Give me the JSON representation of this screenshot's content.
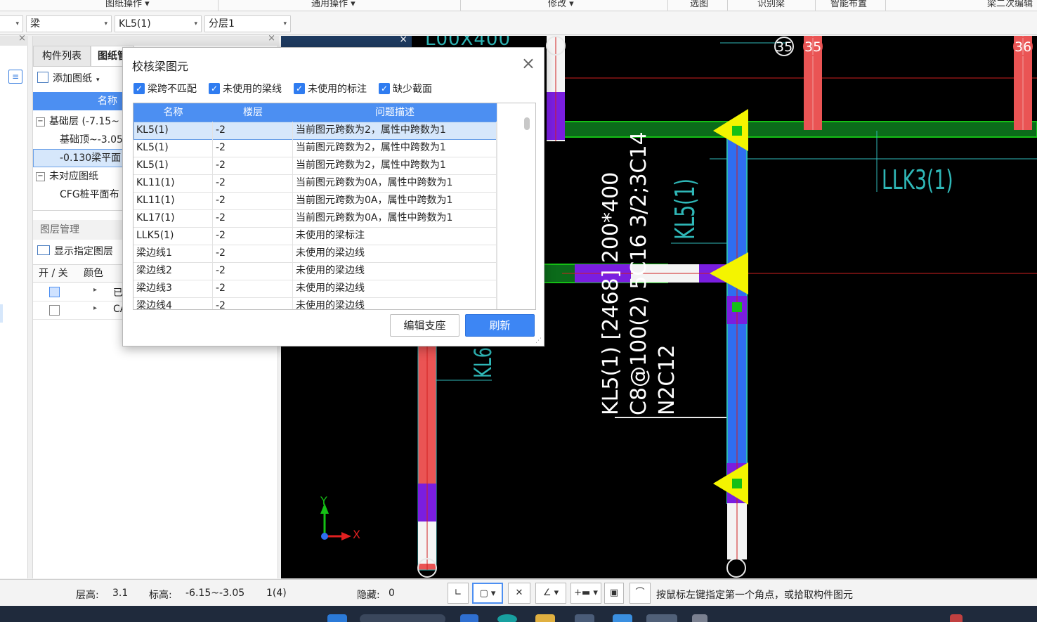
{
  "ribbon": {
    "groups": [
      "图纸操作 ▾",
      "通用操作 ▾",
      "修改 ▾",
      "选图",
      "识别梁",
      "智能布置",
      "梁二次编辑"
    ]
  },
  "selectors": {
    "first_arrow": "▾",
    "element_type": "梁",
    "element_name": "KL5(1)",
    "layer": "分层1"
  },
  "left_panel": {
    "tabs": [
      "构件列表",
      "图纸管"
    ],
    "add_drawing": "添加图纸",
    "column_header": "名称",
    "tree": [
      {
        "label": "基础层 (-7.15~",
        "level": 0,
        "expander": "−"
      },
      {
        "label": "基础顶~-3.05",
        "level": 1
      },
      {
        "label": "-0.130梁平面",
        "level": 1,
        "selected": true
      },
      {
        "label": "未对应图纸",
        "level": 0,
        "expander": "−"
      },
      {
        "label": "CFG桩平面布",
        "level": 1
      }
    ],
    "layer_mgmt": "图层管理",
    "show_layers": "显示指定图层",
    "layer_cols": [
      "开 / 关",
      "颜色"
    ],
    "layer_rows": [
      {
        "arrow": "▸",
        "name": "已"
      },
      {
        "arrow": "▸",
        "name": "CA"
      }
    ]
  },
  "canvas": {
    "grid_bubbles": [
      "35",
      "35",
      "36"
    ],
    "beam_title": "LLK3(1)",
    "beam_tag_kl5": "KL5(1)",
    "annotation": {
      "line1": "KL5(1) [2468] 200*400",
      "line2": "C8@100(2) 5C16 3/2;3C14",
      "line3": "N2C12"
    },
    "top_label": "L00X400",
    "left_tag": "KL6",
    "axis_x": "X",
    "axis_y": "Y",
    "inner_close": "×",
    "colors": {
      "red_beam": "#ea5454",
      "purple": "#7a1ee0",
      "blue_beam": "#2f6ef0",
      "yellow": "#f4f400",
      "green": "#15c015",
      "cyan": "#2fb8b8"
    }
  },
  "dialog": {
    "title": "校核梁图元",
    "close": "×",
    "filters": [
      "梁跨不匹配",
      "未使用的梁线",
      "未使用的标注",
      "缺少截面"
    ],
    "columns": [
      "名称",
      "楼层",
      "问题描述"
    ],
    "rows": [
      {
        "name": "KL5(1)",
        "floor": "-2",
        "desc": "当前图元跨数为2，属性中跨数为1"
      },
      {
        "name": "KL5(1)",
        "floor": "-2",
        "desc": "当前图元跨数为2，属性中跨数为1"
      },
      {
        "name": "KL5(1)",
        "floor": "-2",
        "desc": "当前图元跨数为2，属性中跨数为1"
      },
      {
        "name": "KL11(1)",
        "floor": "-2",
        "desc": "当前图元跨数为0A，属性中跨数为1"
      },
      {
        "name": "KL11(1)",
        "floor": "-2",
        "desc": "当前图元跨数为0A，属性中跨数为1"
      },
      {
        "name": "KL17(1)",
        "floor": "-2",
        "desc": "当前图元跨数为0A，属性中跨数为1"
      },
      {
        "name": "LLK5(1)",
        "floor": "-2",
        "desc": "未使用的梁标注"
      },
      {
        "name": "梁边线1",
        "floor": "-2",
        "desc": "未使用的梁边线"
      },
      {
        "name": "梁边线2",
        "floor": "-2",
        "desc": "未使用的梁边线"
      },
      {
        "name": "梁边线3",
        "floor": "-2",
        "desc": "未使用的梁边线"
      },
      {
        "name": "梁边线4",
        "floor": "-2",
        "desc": "未使用的梁边线"
      }
    ],
    "buttons": {
      "edit_support": "编辑支座",
      "refresh": "刷新"
    }
  },
  "status": {
    "floor_height_label": "层高:",
    "floor_height": "3.1",
    "elevation_label": "标高:",
    "elevation": "-6.15~-3.05",
    "count": "1(4)",
    "hidden_label": "隐藏:",
    "hidden": "0",
    "prompt": "按鼠标左键指定第一个角点，或拾取构件图元"
  }
}
